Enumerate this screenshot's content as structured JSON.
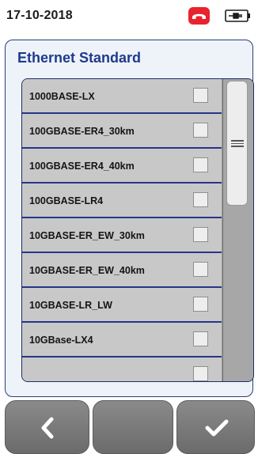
{
  "status_bar": {
    "date": "17-10-2018",
    "phone_icon": "phone-hangup-icon",
    "phone_color": "#e8232d",
    "battery_icon": "battery-plug-icon"
  },
  "panel": {
    "title": "Ethernet Standard",
    "title_color": "#1f3a8c"
  },
  "list": {
    "items": [
      {
        "label": "1000BASE-LX",
        "checked": false
      },
      {
        "label": "100GBASE-ER4_30km",
        "checked": false
      },
      {
        "label": "100GBASE-ER4_40km",
        "checked": false
      },
      {
        "label": "100GBASE-LR4",
        "checked": false
      },
      {
        "label": "10GBASE-ER_EW_30km",
        "checked": false
      },
      {
        "label": "10GBASE-ER_EW_40km",
        "checked": false
      },
      {
        "label": "10GBASE-LR_LW",
        "checked": false
      },
      {
        "label": "10GBase-LX4",
        "checked": false
      },
      {
        "label": "",
        "checked": false
      }
    ]
  },
  "bottom_bar": {
    "back_icon": "chevron-left-icon",
    "middle_icon": "",
    "confirm_icon": "checkmark-icon"
  }
}
